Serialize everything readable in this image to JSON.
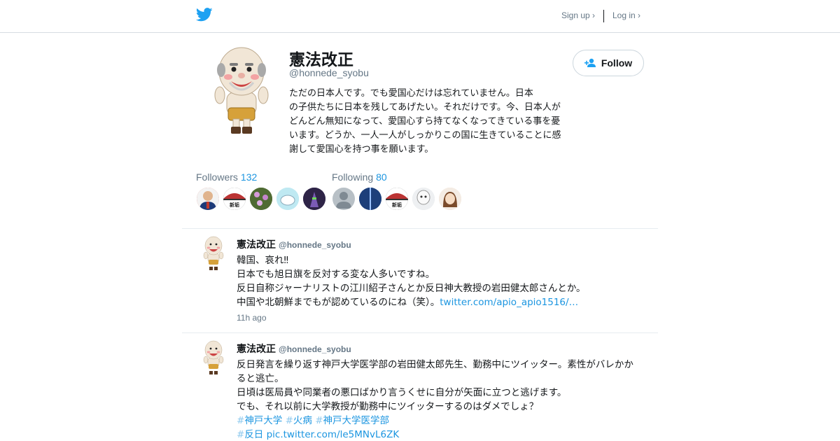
{
  "header": {
    "logo_icon": "twitter-bird-icon",
    "signup_label": "Sign up ›",
    "login_label": "Log in ›"
  },
  "profile": {
    "name": "憲法改正",
    "handle": "@honnede_syobu",
    "bio_lines": [
      "ただの日本人です。でも愛国心だけは忘れていません。日本",
      "の子供たちに日本を残してあげたい。それだけです。今、日本人が",
      "どんどん無知になって、愛国心すら持てなくなってきている事を憂",
      "います。どうか、一人一人がしっかりこの国に生きていることに感",
      "謝して愛国心を持つ事を願います。"
    ],
    "follow_label": "Follow",
    "follow_icon": "add-person-icon"
  },
  "stats": {
    "followers_label": "Followers",
    "followers_count": "132",
    "following_label": "Following",
    "following_count": "80"
  },
  "followers_avatars": [
    {
      "name": "avatar-man-suit",
      "bg": "#c84c3c"
    },
    {
      "name": "avatar-shinkan",
      "bg": "#2a2a2a",
      "caption": "新垢"
    },
    {
      "name": "avatar-flowers",
      "bg": "#5d7a3a"
    },
    {
      "name": "avatar-cartoon-sky",
      "bg": "#aee3ec"
    },
    {
      "name": "avatar-purple-robot",
      "bg": "#3e2f5b"
    }
  ],
  "following_avatars": [
    {
      "name": "avatar-default",
      "bg": "#b8c0c6"
    },
    {
      "name": "avatar-blue-sky",
      "bg": "#1d3f7a"
    },
    {
      "name": "avatar-shinkan",
      "bg": "#2a2a2a",
      "caption": "新垢"
    },
    {
      "name": "avatar-white-figure",
      "bg": "#dde1e4"
    },
    {
      "name": "avatar-anime-girl",
      "bg": "#e8d6c4"
    }
  ],
  "tweets": [
    {
      "name": "憲法改正",
      "handle": "@honnede_syobu",
      "lines": [
        "韓国、哀れ‼",
        "日本でも旭日旗を反対する変な人多いですね。",
        "反日自称ジャーナリストの江川紹子さんとか反日神大教授の岩田健太郎さんとか。"
      ],
      "last_line_text": "中国や北朝鮮までもが認めているのにね（笑）。",
      "last_line_link": "twitter.com/apio_apio1516/…",
      "time": "11h ago"
    },
    {
      "name": "憲法改正",
      "handle": "@honnede_syobu",
      "lines": [
        "反日発言を繰り返す神戸大学医学部の岩田健太郎先生、勤務中にツイッター。素性がバレかか",
        "ると逃亡。",
        "日頃は医局員や同業者の悪口ばかり言うくせに自分が矢面に立つと逃げます。",
        "でも、それ以前に大学教授が勤務中にツイッターするのはダメでしょ？"
      ],
      "hashtags_line1": [
        "神戸大学",
        "火病",
        "神戸大学医学部"
      ],
      "hashtag_line2": "反日",
      "pic_link": "pic.twitter.com/le5MNvL6ZK"
    }
  ]
}
